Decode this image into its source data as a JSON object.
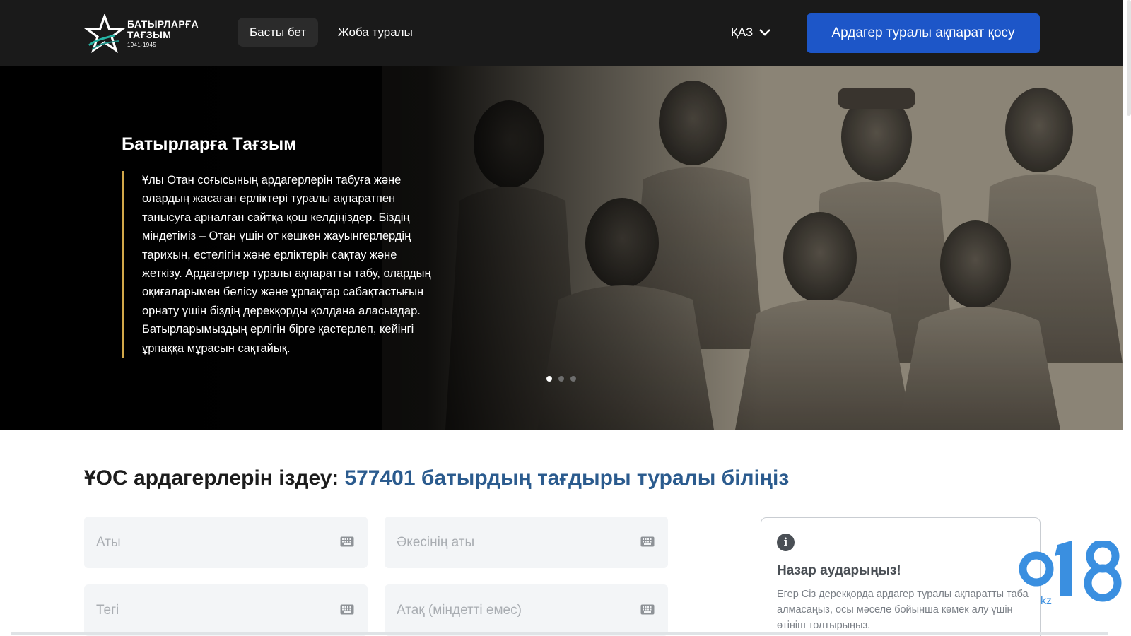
{
  "header": {
    "logo": {
      "line1": "БАТЫРЛАРҒА",
      "line2": "ТАҒЗЫМ",
      "years": "1941-1945",
      "icon": "star-icon"
    },
    "nav": {
      "home": "Басты бет",
      "about": "Жоба туралы"
    },
    "language": {
      "current": "ҚАЗ",
      "icon": "chevron-down-icon"
    },
    "add_button": "Ардагер туралы ақпарат қосу"
  },
  "hero": {
    "title": "Батырларға Тағзым",
    "text": "Ұлы Отан соғысының ардагерлерін табуға және олардың жасаған ерліктері туралы ақпаратпен танысуға арналған сайтқа қош келдіңіздер. Біздің міндетіміз – Отан үшін от кешкен жауынгерлердің тарихын, естелігін және ерліктерін сақтау және жеткізу. Ардагерлер туралы ақпаратты табу, олардың оқиғаларымен бөлісу және ұрпақтар сабақтастығын орнату үшін біздің дерекқорды қолдана аласыздар. Батырларымыздың ерлігін бірге қастерлеп, кейінгі ұрпаққа мұрасын сақтайық.",
    "slides_total": 3,
    "active_slide": 1
  },
  "search": {
    "heading_prefix": "ҰОС ардагерлерін іздеу: ",
    "heading_highlight": "577401 батырдың тағдыры туралы біліңіз",
    "fields": {
      "first_name": "Аты",
      "patronymic": "Әкесінің аты",
      "last_name": "Тегі",
      "rank": "Атақ (міндетті емес)"
    },
    "field_icon": "keyboard-icon"
  },
  "notice": {
    "icon": "info-icon",
    "icon_glyph": "i",
    "title": "Назар аударыңыз!",
    "text": "Егер Сіз дерекқорда ардагер туралы ақпаратты таба алмасаңыз, осы мәселе бойынша көмек алу үшін өтініш толтырыңыз."
  },
  "watermark": {
    "main": "018",
    "sub": "kz"
  },
  "colors": {
    "header_bg": "#1a1a1a",
    "accent_blue": "#1d56c8",
    "heading_highlight": "#2b5b8e",
    "quote_border": "#d2a84a",
    "watermark_blue": "#3a8fe0"
  }
}
